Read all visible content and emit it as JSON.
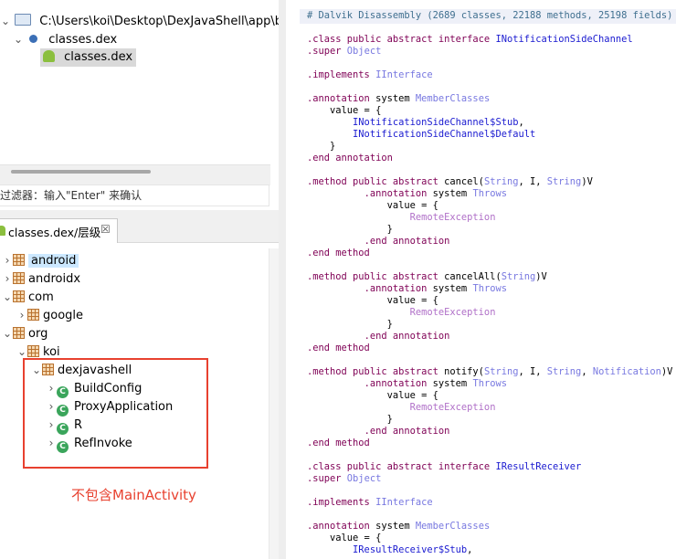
{
  "top_tree": {
    "path": "C:\\Users\\koi\\Desktop\\DexJavaShell\\app\\buil",
    "dex_node": "classes.dex",
    "dex_file": "classes.dex"
  },
  "filter": {
    "label": "过滤器：输入\"Enter\" 来确认"
  },
  "hierarchy_tab": {
    "label": "classes.dex/层级",
    "close": "☒"
  },
  "tree": [
    {
      "label": "android",
      "arrow": "›",
      "type": "pkg",
      "indent": 0,
      "selected": true
    },
    {
      "label": "androidx",
      "arrow": "›",
      "type": "pkg",
      "indent": 0
    },
    {
      "label": "com",
      "arrow": "⌄",
      "type": "pkg",
      "indent": 0
    },
    {
      "label": "google",
      "arrow": "›",
      "type": "pkg",
      "indent": 1
    },
    {
      "label": "org",
      "arrow": "⌄",
      "type": "pkg",
      "indent": 0
    },
    {
      "label": "koi",
      "arrow": "⌄",
      "type": "pkg",
      "indent": 1
    },
    {
      "label": "dexjavashell",
      "arrow": "⌄",
      "type": "pkg",
      "indent": 2
    },
    {
      "label": "BuildConfig",
      "arrow": "›",
      "type": "cls",
      "indent": 3
    },
    {
      "label": "ProxyApplication",
      "arrow": "›",
      "type": "cls",
      "indent": 3
    },
    {
      "label": "R",
      "arrow": "›",
      "type": "cls",
      "indent": 3
    },
    {
      "label": "RefInvoke",
      "arrow": "›",
      "type": "cls",
      "indent": 3
    }
  ],
  "annotation": "不包含MainActivity",
  "colors": {
    "annotation_red": "#e8412f",
    "selection": "#cce8ff",
    "keyword": "#7f0055"
  },
  "code_lines": [
    [
      [
        "cm",
        "# Dalvik Disassembly (2689 classes, 22188 methods, 25198 fields)"
      ]
    ],
    [],
    [
      [
        "kw",
        ".class public abstract interface "
      ],
      [
        "nm",
        "INotificationSideChannel"
      ]
    ],
    [
      [
        "kw",
        ".super "
      ],
      [
        "tp",
        "Object"
      ]
    ],
    [],
    [
      [
        "kw",
        ".implements "
      ],
      [
        "tp",
        "IInterface"
      ]
    ],
    [],
    [
      [
        "kw",
        ".annotation "
      ],
      [
        "",
        "system "
      ],
      [
        "tp",
        "MemberClasses"
      ]
    ],
    [
      [
        "",
        "    value = {"
      ]
    ],
    [
      [
        "",
        "        "
      ],
      [
        "nm",
        "INotificationSideChannel$Stub"
      ],
      [
        "",
        ","
      ]
    ],
    [
      [
        "",
        "        "
      ],
      [
        "nm",
        "INotificationSideChannel$Default"
      ]
    ],
    [
      [
        "",
        "    }"
      ]
    ],
    [
      [
        "kw",
        ".end annotation"
      ]
    ],
    [],
    [
      [
        "kw",
        ".method public abstract "
      ],
      [
        "",
        "cancel("
      ],
      [
        "tp",
        "String"
      ],
      [
        "",
        ", I, "
      ],
      [
        "tp",
        "String"
      ],
      [
        "",
        ")V"
      ]
    ],
    [
      [
        "",
        "          "
      ],
      [
        "kw",
        ".annotation "
      ],
      [
        "",
        "system "
      ],
      [
        "tp",
        "Throws"
      ]
    ],
    [
      [
        "",
        "              value = {"
      ]
    ],
    [
      [
        "",
        "                  "
      ],
      [
        "ex",
        "RemoteException"
      ]
    ],
    [
      [
        "",
        "              }"
      ]
    ],
    [
      [
        "",
        "          "
      ],
      [
        "kw",
        ".end annotation"
      ]
    ],
    [
      [
        "kw",
        ".end method"
      ]
    ],
    [],
    [
      [
        "kw",
        ".method public abstract "
      ],
      [
        "",
        "cancelAll("
      ],
      [
        "tp",
        "String"
      ],
      [
        "",
        ")V"
      ]
    ],
    [
      [
        "",
        "          "
      ],
      [
        "kw",
        ".annotation "
      ],
      [
        "",
        "system "
      ],
      [
        "tp",
        "Throws"
      ]
    ],
    [
      [
        "",
        "              value = {"
      ]
    ],
    [
      [
        "",
        "                  "
      ],
      [
        "ex",
        "RemoteException"
      ]
    ],
    [
      [
        "",
        "              }"
      ]
    ],
    [
      [
        "",
        "          "
      ],
      [
        "kw",
        ".end annotation"
      ]
    ],
    [
      [
        "kw",
        ".end method"
      ]
    ],
    [],
    [
      [
        "kw",
        ".method public abstract "
      ],
      [
        "",
        "notify("
      ],
      [
        "tp",
        "String"
      ],
      [
        "",
        ", I, "
      ],
      [
        "tp",
        "String"
      ],
      [
        "",
        ", "
      ],
      [
        "tp",
        "Notification"
      ],
      [
        "",
        ")V"
      ]
    ],
    [
      [
        "",
        "          "
      ],
      [
        "kw",
        ".annotation "
      ],
      [
        "",
        "system "
      ],
      [
        "tp",
        "Throws"
      ]
    ],
    [
      [
        "",
        "              value = {"
      ]
    ],
    [
      [
        "",
        "                  "
      ],
      [
        "ex",
        "RemoteException"
      ]
    ],
    [
      [
        "",
        "              }"
      ]
    ],
    [
      [
        "",
        "          "
      ],
      [
        "kw",
        ".end annotation"
      ]
    ],
    [
      [
        "kw",
        ".end method"
      ]
    ],
    [],
    [
      [
        "kw",
        ".class public abstract interface "
      ],
      [
        "nm",
        "IResultReceiver"
      ]
    ],
    [
      [
        "kw",
        ".super "
      ],
      [
        "tp",
        "Object"
      ]
    ],
    [],
    [
      [
        "kw",
        ".implements "
      ],
      [
        "tp",
        "IInterface"
      ]
    ],
    [],
    [
      [
        "kw",
        ".annotation "
      ],
      [
        "",
        "system "
      ],
      [
        "tp",
        "MemberClasses"
      ]
    ],
    [
      [
        "",
        "    value = {"
      ]
    ],
    [
      [
        "",
        "        "
      ],
      [
        "nm",
        "IResultReceiver$Stub"
      ],
      [
        "",
        ","
      ]
    ]
  ]
}
